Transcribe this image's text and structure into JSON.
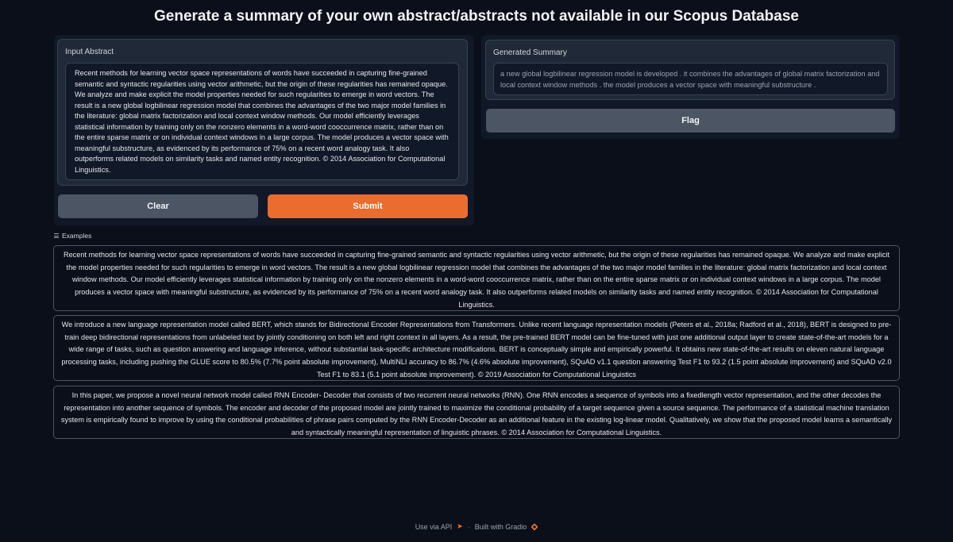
{
  "page": {
    "title": "Generate a summary of your own abstract/abstracts not available in our Scopus Database"
  },
  "input": {
    "label": "Input Abstract",
    "value": "Recent methods for learning vector space representations of words have succeeded in capturing fine-grained semantic and syntactic regularities using vector arithmetic, but the origin of these regularities has remained opaque. We analyze and make explicit the model properties needed for such regularities to emerge in word vectors. The result is a new global logbilinear regression model that combines the advantages of the two major model families in the literature: global matrix factorization and local context window methods. Our model efficiently leverages statistical information by training only on the nonzero elements in a word-word cooccurrence matrix, rather than on the entire sparse matrix or on individual context windows in a large corpus. The model produces a vector space with meaningful substructure, as evidenced by its performance of 75% on a recent word analogy task. It also outperforms related models on similarity tasks and named entity recognition. © 2014 Association for Computational Linguistics."
  },
  "buttons": {
    "clear": "Clear",
    "submit": "Submit",
    "flag": "Flag"
  },
  "output": {
    "label": "Generated Summary",
    "value": "a new global logbilinear regression model is developed . it combines the advantages of global matrix factorization and local context window methods . the model produces a vector space with meaningful substructure ."
  },
  "examples": {
    "label": "Examples",
    "icon": "list-icon",
    "items": [
      "Recent methods for learning vector space representations of words have succeeded in capturing fine-grained semantic and syntactic regularities using vector arithmetic, but the origin of these regularities has remained opaque. We analyze and make explicit the model properties needed for such regularities to emerge in word vectors. The result is a new global logbilinear regression model that combines the advantages of the two major model families in the literature: global matrix factorization and local context window methods. Our model efficiently leverages statistical information by training only on the nonzero elements in a word-word cooccurrence matrix, rather than on the entire sparse matrix or on individual context windows in a large corpus. The model produces a vector space with meaningful substructure, as evidenced by its performance of 75% on a recent word analogy task. It also outperforms related models on similarity tasks and named entity recognition. © 2014 Association for Computational Linguistics.",
      "We introduce a new language representation model called BERT, which stands for Bidirectional Encoder Representations from Transformers. Unlike recent language representation models (Peters et al., 2018a; Radford et al., 2018), BERT is designed to pre-train deep bidirectional representations from unlabeled text by jointly conditioning on both left and right context in all layers. As a result, the pre-trained BERT model can be fine-tuned with just one additional output layer to create state-of-the-art models for a wide range of tasks, such as question answering and language inference, without substantial task-specific architecture modifications. BERT is conceptually simple and empirically powerful. It obtains new state-of-the-art results on eleven natural language processing tasks, including pushing the GLUE score to 80.5% (7.7% point absolute improvement), MultiNLI accuracy to 86.7% (4.6% absolute improvement), SQuAD v1.1 question answering Test F1 to 93.2 (1.5 point absolute improvement) and SQuAD v2.0 Test F1 to 83.1 (5.1 point absolute improvement). © 2019 Association for Computational Linguistics",
      "In this paper, we propose a novel neural network model called RNN Encoder- Decoder that consists of two recurrent neural networks (RNN). One RNN encodes a sequence of symbols into a fixedlength vector representation, and the other decodes the representation into another sequence of symbols. The encoder and decoder of the proposed model are jointly trained to maximize the conditional probability of a target sequence given a source sequence. The performance of a statistical machine translation system is empirically found to improve by using the conditional probabilities of phrase pairs computed by the RNN Encoder-Decoder as an additional feature in the existing log-linear model. Qualitatively, we show that the proposed model learns a semantically and syntactically meaningful representation of linguistic phrases. © 2014 Association for Computational Linguistics."
    ]
  },
  "footer": {
    "api_link": "Use via API",
    "api_icon": "rocket-icon",
    "separator": "·",
    "built_with": "Built with Gradio",
    "gradio_icon": "gradio-logo-icon"
  }
}
